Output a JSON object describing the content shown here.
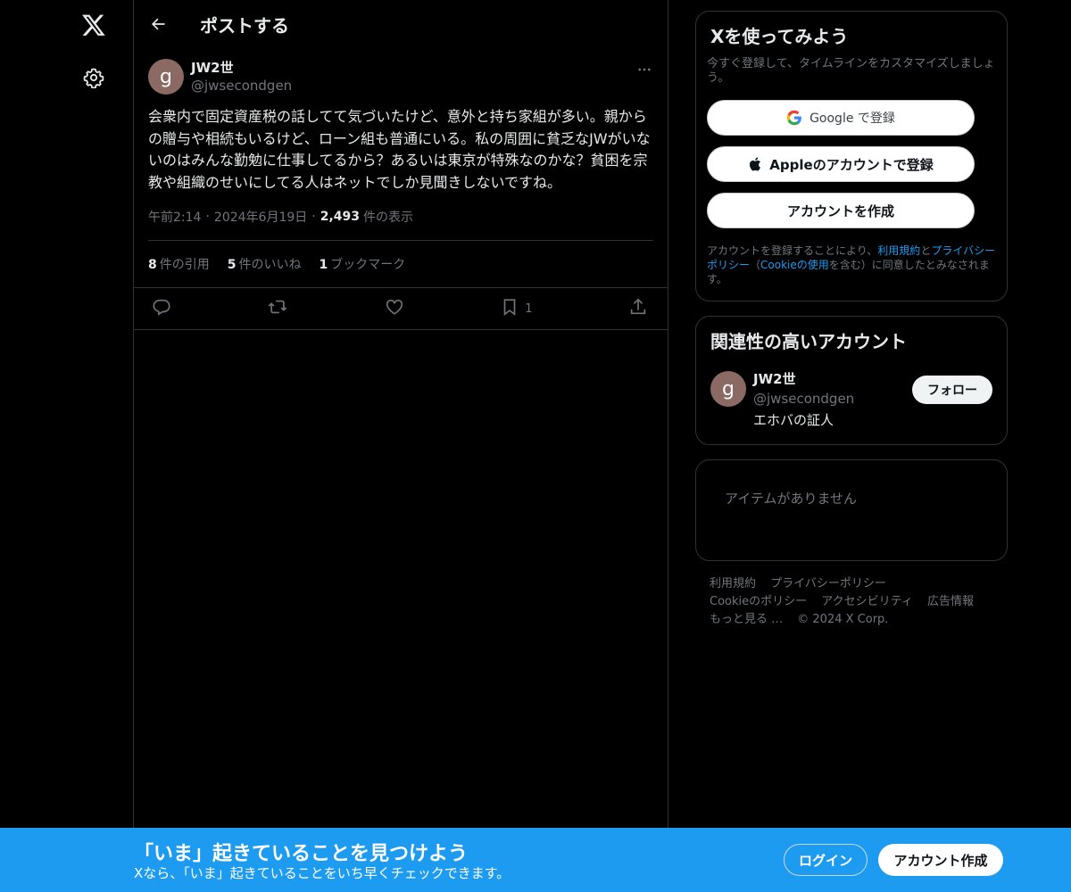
{
  "header": {
    "title": "ポストする"
  },
  "post": {
    "avatar_letter": "g",
    "display_name": "JW2世",
    "handle": "@jwsecondgen",
    "text": "会衆内で固定資産税の話してて気づいたけど、意外と持ち家組が多い。親からの贈与や相続もいるけど、ローン組も普通にいる。私の周囲に貧乏なJWがいないのはみんな勤勉に仕事してるから？あるいは東京が特殊なのかな？貧困を宗教や組織のせいにしてる人はネットでしか見聞きしないですね。",
    "time": "午前2:14",
    "date": "2024年6月19日",
    "views_count": "2,493",
    "views_label": "件の表示",
    "dot": "·",
    "stats": [
      {
        "num": "8",
        "label": "件の引用"
      },
      {
        "num": "5",
        "label": "件のいいね"
      },
      {
        "num": "1",
        "label": "ブックマーク"
      }
    ],
    "bookmark_count": "1"
  },
  "signup": {
    "title": "Xを使ってみよう",
    "subtitle": "今すぐ登録して、タイムラインをカスタマイズしましょう。",
    "google_label": "Google で登録",
    "apple_label": "Appleのアカウントで登録",
    "create_label": "アカウントを作成",
    "legal_1": "アカウントを登録することにより、",
    "legal_terms": "利用規約",
    "legal_2": "と",
    "legal_privacy": "プライバシーポリシー",
    "legal_3": "（",
    "legal_cookie": "Cookieの使用",
    "legal_4": "を含む）に同意したとみなされます。"
  },
  "related": {
    "title": "関連性の高いアカウント",
    "avatar_letter": "g",
    "name": "JW2世",
    "handle": "@jwsecondgen",
    "bio": "エホバの証人",
    "follow_label": "フォロー"
  },
  "empty": {
    "text": "アイテムがありません"
  },
  "footer": {
    "terms": "利用規約",
    "privacy": "プライバシーポリシー",
    "cookie": "Cookieのポリシー",
    "accessibility": "アクセシビリティ",
    "ads": "広告情報",
    "more": "もっと見る …",
    "copyright": "© 2024 X Corp."
  },
  "banner": {
    "title": "「いま」起きていることを見つけよう",
    "subtitle": "Xなら、「いま」起きていることをいち早くチェックできます。",
    "login_label": "ログイン",
    "signup_label": "アカウント作成"
  },
  "colors": {
    "accent": "#1d9bf0",
    "border": "#2f3336",
    "muted": "#71767b",
    "text": "#e7e9ea"
  },
  "icons": [
    "x-logo-icon",
    "gear-icon",
    "back-arrow-icon",
    "more-icon",
    "reply-icon",
    "repost-icon",
    "like-icon",
    "bookmark-icon",
    "share-icon",
    "google-icon",
    "apple-icon"
  ]
}
